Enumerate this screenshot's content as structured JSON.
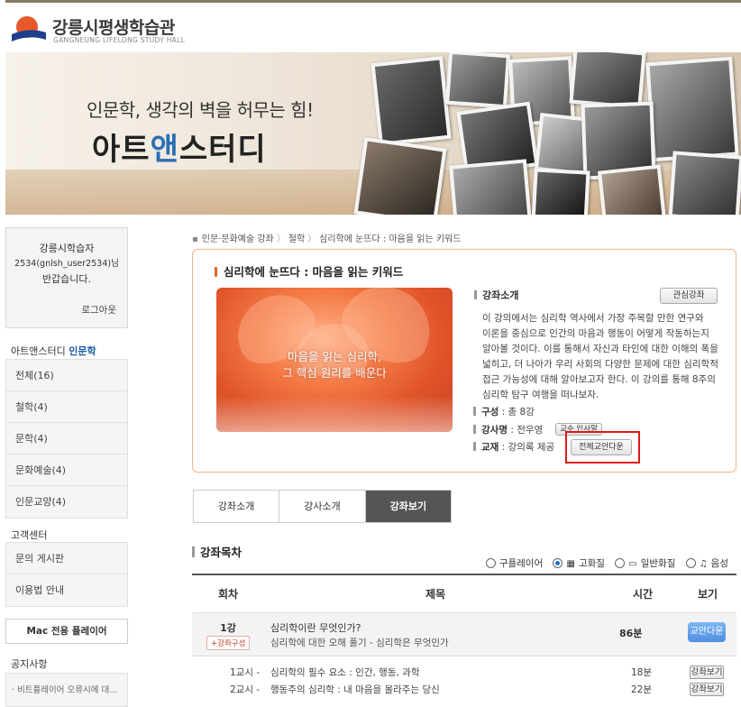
{
  "site": {
    "logo_name": "강릉시평생학습관",
    "logo_sub": "GANGNEUNG LIFELONG STUDY HALL"
  },
  "banner": {
    "tagline": "인문학, 생각의 벽을 허무는 힘!",
    "title_part1": "아트",
    "title_part2": "앤",
    "title_part3": "스터디"
  },
  "login": {
    "line1": "강릉시학습자",
    "line2": "2534(gnlsh_user2534)님",
    "line3": "반갑습니다.",
    "logout": "로그아웃"
  },
  "category": {
    "title_prefix": "아트앤스터디 ",
    "title_highlight": "인문학",
    "items": [
      "전체(16)",
      "철학(4)",
      "문학(4)",
      "문화예술(4)",
      "인문교양(4)"
    ]
  },
  "support": {
    "title": "고객센터",
    "items": [
      "문의 게시판",
      "이용법 안내"
    ]
  },
  "mac_player": "Mac 전용 플레이어",
  "notice": {
    "title": "공지사항",
    "item": "· 비트플레이어 오류시에 대..."
  },
  "breadcrumb": [
    "인문·문화예술 강좌",
    "철학",
    "심리학에 눈뜨다 : 마음을 읽는 키워드"
  ],
  "course": {
    "title": "심리학에 눈뜨다 : 마음을 읽는 키워드",
    "thumb_line1": "마음을 읽는 심리학,",
    "thumb_line2": "그 핵심 원리를 배운다",
    "intro_label": "강좌소개",
    "interest_btn": "관심강좌",
    "description": "이 강의에서는 심리학 역사에서 가장 주목할 만한 연구와 이론을 중심으로 인간의 마음과 행동이 어떻게 작동하는지 알아볼 것이다. 이를 통해서 자신과 타인에 대한 이해의 폭을 넓히고, 더 나아가 우리 사회의 다양한 문제에 대한 심리학적 접근 가능성에 대해 알아보고자 한다. 이 강의를 통해 8주의 심리학 탐구 여행을 떠나보자.",
    "composition_label": "구성",
    "composition_value": " : 총 8강",
    "lecturer_label": "강사명",
    "lecturer_value": " : 전우영",
    "lecturer_btn": "교수 인사말",
    "textbook_label": "교재",
    "textbook_value": " : 강의록 제공",
    "download_all_btn": "전체교안다운"
  },
  "tabs": [
    "강좌소개",
    "강사소개",
    "강좌보기"
  ],
  "toc": {
    "title": "강좌목차",
    "radios": [
      {
        "label": "구플레이어",
        "icon": "",
        "selected": false
      },
      {
        "label": "고화질",
        "icon": "▦",
        "selected": true
      },
      {
        "label": "일반화질",
        "icon": "▭",
        "selected": false
      },
      {
        "label": "음성",
        "icon": "♫",
        "selected": false
      }
    ],
    "headers": [
      "회차",
      "제목",
      "시간",
      "보기"
    ],
    "lecture": {
      "no": "1강",
      "tag": "+강좌구성",
      "title": "심리학이란 무엇인가?",
      "subtitle": "심리학에 대한 오해 풀기 - 심리학은 무엇인가",
      "time": "86분",
      "button": "교안다운"
    },
    "sessions": [
      {
        "no": "1교시 -",
        "title": "심리학의 필수 요소 : 인간, 행동, 과학",
        "time": "18분",
        "button": "강좌보기"
      },
      {
        "no": "2교시 -",
        "title": "행동주의 심리학 : 내 마음을 몰라주는 당신",
        "time": "22분",
        "button": "강좌보기"
      }
    ]
  },
  "colors": {
    "accent_orange": "#e8622a",
    "accent_blue": "#1d5aa8",
    "highlight_red": "#e01818"
  }
}
